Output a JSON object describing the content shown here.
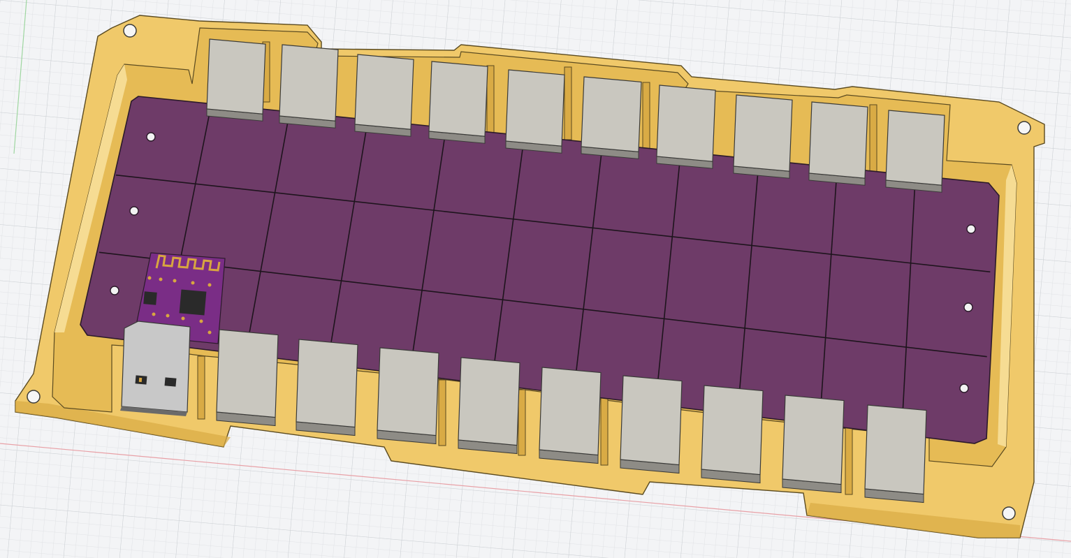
{
  "scene": {
    "description_name": "cad-viewport",
    "colors": {
      "background": "#f3f4f6",
      "grid_minor": "#e1e3e6",
      "grid_major": "#cfd2d6",
      "axis_x": "#e8a0a6",
      "axis_y": "#9ed6a0",
      "case": "#f0c96a",
      "case_shadow": "#d9ab45",
      "case_inner": "#e6bb55",
      "case_edge": "#5a4a20",
      "pcb": "#6e3b68",
      "pcb_edge": "#2b1a2a",
      "pcb_line": "#1e141d",
      "key": "#c9c7bf",
      "key_side": "#8e8c86",
      "key_edge": "#3a3a38",
      "module": "#7a2d86",
      "chip": "#2a2a2a",
      "usb": "#c8c8c8",
      "usb_dark": "#6a6a6a",
      "gold": "#d8a640"
    },
    "layout": {
      "pcb_grid_columns": 11,
      "pcb_grid_rows": 3,
      "top_keys": 10,
      "bottom_keys": 9,
      "mounting_holes": 4,
      "pcb_holes": 6
    }
  }
}
